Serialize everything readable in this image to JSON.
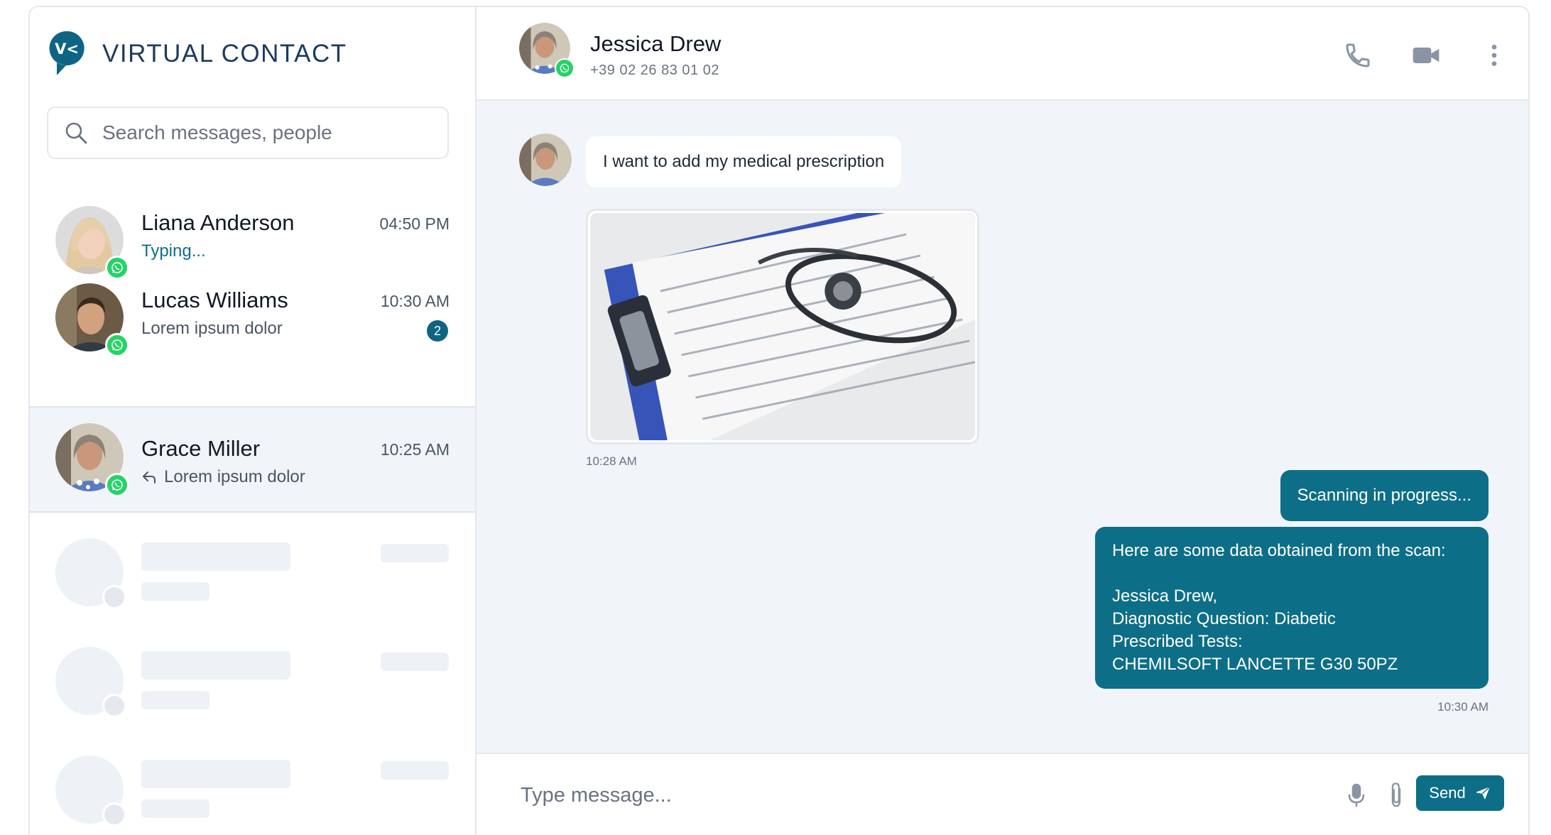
{
  "brand": {
    "name": "VIRTUAL CONTACT",
    "logo_text": "V<"
  },
  "search": {
    "placeholder": "Search messages, people"
  },
  "contacts": [
    {
      "name": "Liana Anderson",
      "time": "04:50 PM",
      "preview": "Typing...",
      "status": "typing",
      "channel": "whatsapp"
    },
    {
      "name": "Lucas Williams",
      "time": "10:30 AM",
      "preview": "Lorem ipsum dolor",
      "unread": "2",
      "channel": "whatsapp"
    },
    {
      "name": "Grace Miller",
      "time": "10:25 AM",
      "preview": "Lorem ipsum dolor",
      "replied": true,
      "active": true,
      "channel": "whatsapp"
    }
  ],
  "chat": {
    "header": {
      "name": "Jessica Drew",
      "phone": "+39 02 26 83 01 02",
      "channel": "whatsapp"
    },
    "header_icons": [
      "phone-icon",
      "video-camera-icon",
      "more-vertical-icon"
    ],
    "messages": {
      "incoming_text": "I want to add my medical prescription",
      "incoming_image_time": "10:28 AM",
      "outgoing_status": "Scanning in progress...",
      "outgoing_data": {
        "lines": [
          "Here are some data obtained from the scan:",
          "",
          "Jessica Drew,",
          "Diagnostic Question: Diabetic",
          "Prescribed Tests:",
          "CHEMILSOFT LANCETTE G30 50PZ"
        ],
        "time": "10:30 AM"
      }
    },
    "composer": {
      "placeholder": "Type message...",
      "send_label": "Send"
    }
  },
  "colors": {
    "brand": "#0e6583",
    "accent": "#0d6e87",
    "whatsapp": "#25d366",
    "chat_bg": "#f1f5f9"
  }
}
